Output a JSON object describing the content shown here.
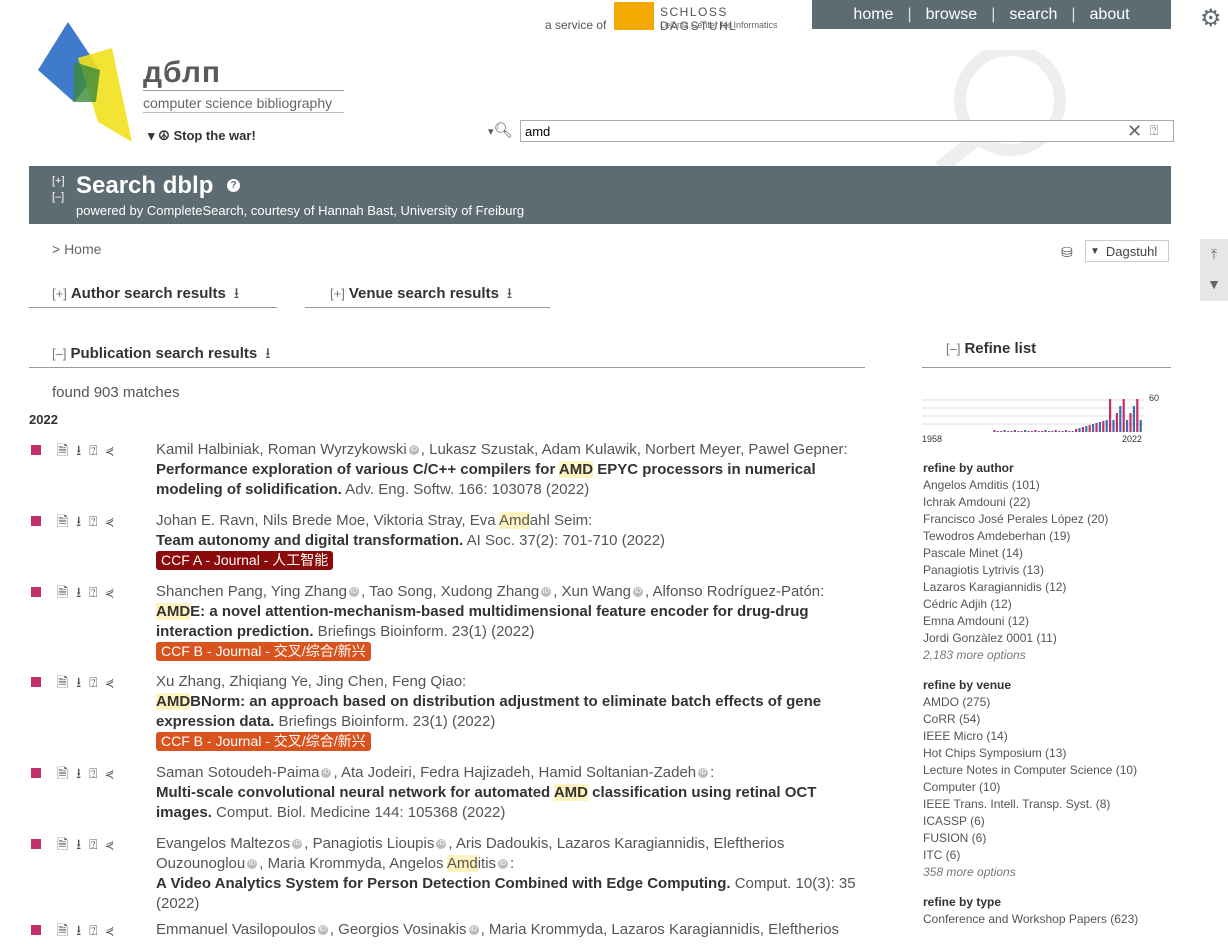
{
  "header": {
    "service_label": "a service of",
    "dagstuhl_name": "SCHLOSS DAGSTUHL",
    "dagstuhl_sub": "Leibniz Center for Informatics",
    "nav": [
      "home",
      "browse",
      "search",
      "about"
    ],
    "logo_title": "дблп",
    "logo_subtitle": "computer science bibliography",
    "stop_war": "Stop the war!"
  },
  "search": {
    "value": "amd"
  },
  "banner": {
    "toggle_expand": "[+]",
    "toggle_collapse": "[–]",
    "title": "Search dblp",
    "help_icon": "?",
    "powered_by_prefix": "powered by",
    "powered_by_link": "CompleteSearch",
    "courtesy_prefix": ", courtesy of",
    "courtesy_person": "Hannah Bast",
    "courtesy_org": "University of Freiburg"
  },
  "breadcrumb": "> Home",
  "mirror": {
    "selected": "Dagstuhl"
  },
  "sections": {
    "author_toggle": "[+]",
    "author_label": "Author search results",
    "venue_toggle": "[+]",
    "venue_label": "Venue search results",
    "pub_toggle": "[–]",
    "pub_label": "Publication search results"
  },
  "found": "found 903 matches",
  "year": "2022",
  "entries": [
    {
      "authors": "Kamil Halbiniak, Roman Wyrzykowski",
      "authors2": ", Lukasz Szustak, Adam Kulawik, Norbert Meyer, Pawel Gepner:",
      "title_pre": "Performance exploration of various C/C++ compilers for ",
      "title_hl": "AMD",
      "title_post": " EPYC processors in numerical modeling of solidification.",
      "venue": " Adv. Eng. Softw. 166: 103078 (2022)",
      "ccf": ""
    },
    {
      "authors": "Johan E. Ravn, Nils Brede Moe, Viktoria Stray, Eva ",
      "author_hl": "Amd",
      "authors2": "ahl Seim:",
      "title_pre": "Team autonomy and digital transformation.",
      "title_hl": "",
      "title_post": "",
      "venue": " AI Soc. 37(2): 701-710 (2022)",
      "ccf": "CCF A - Journal - 人工智能"
    },
    {
      "authors": "Shanchen Pang, Ying Zhang",
      "authors2": ", Tao Song, Xudong Zhang",
      "authors3": ", Xun Wang",
      "authors4": ", Alfonso Rodríguez-Patón:",
      "title_pre": "",
      "title_hl": "AMD",
      "title_post": "E: a novel attention-mechanism-based multidimensional feature encoder for drug-drug interaction prediction.",
      "venue": " Briefings Bioinform. 23(1) (2022)",
      "ccf": "CCF B - Journal - 交叉/综合/新兴"
    },
    {
      "authors": "Xu Zhang, Zhiqiang Ye, Jing Chen, Feng Qiao:",
      "title_pre": "",
      "title_hl": "AMD",
      "title_post": "BNorm: an approach based on distribution adjustment to eliminate batch effects of gene expression data.",
      "venue": " Briefings Bioinform. 23(1) (2022)",
      "ccf": "CCF B - Journal - 交叉/综合/新兴"
    },
    {
      "authors": "Saman Sotoudeh-Paima",
      "authors2": ", Ata Jodeiri, Fedra Hajizadeh, Hamid Soltanian-Zadeh",
      "authors3": ":",
      "title_pre": "Multi-scale convolutional neural network for automated ",
      "title_hl": "AMD",
      "title_post": " classification using retinal OCT images.",
      "venue": " Comput. Biol. Medicine 144: 105368 (2022)",
      "ccf": ""
    },
    {
      "authors": "Evangelos Maltezos",
      "authors2": ", Panagiotis Lioupis",
      "authors3": ", Aris Dadoukis, Lazaros Karagiannidis, Eleftherios Ouzounoglou",
      "authors4": ", Maria Krommyda, Angelos ",
      "author_hl": "Amd",
      "authors5": "itis",
      "authors6": ":",
      "title_pre": "A Video Analytics System for Person Detection Combined with Edge Computing.",
      "title_hl": "",
      "title_post": "",
      "venue": " Comput. 10(3): 35 (2022)",
      "ccf": ""
    },
    {
      "authors": "Emmanuel Vasilopoulos",
      "authors2": ", Georgios Vosinakis",
      "authors3": ", Maria Krommyda, Lazaros Karagiannidis, Eleftherios"
    }
  ],
  "refine": {
    "toggle": "[–]",
    "title": "Refine list",
    "histogram": {
      "start_year": "1958",
      "end_year": "2022",
      "max_label": "60"
    },
    "author_heading": "refine by author",
    "authors": [
      "Angelos Amditis (101)",
      "Ichrak Amdouni (22)",
      "Francisco José Perales López (20)",
      "Tewodros Amdeberhan (19)",
      "Pascale Minet (14)",
      "Panagiotis Lytrivis (13)",
      "Lazaros Karagiannidis (12)",
      "Cédric Adjih (12)",
      "Emna Amdouni (12)",
      "Jordi Gonzàlez 0001 (11)"
    ],
    "author_more": "2,183 more options",
    "venue_heading": "refine by venue",
    "venues": [
      "AMDO (275)",
      "CoRR (54)",
      "IEEE Micro (14)",
      "Hot Chips Symposium (13)",
      "Lecture Notes in Computer Science (10)",
      "Computer (10)",
      "IEEE Trans. Intell. Transp. Syst. (8)",
      "ICASSP (6)",
      "FUSION (6)",
      "ITC (6)"
    ],
    "venue_more": "358 more options",
    "type_heading": "refine by type",
    "types": [
      "Conference and Workshop Papers (623)"
    ]
  }
}
